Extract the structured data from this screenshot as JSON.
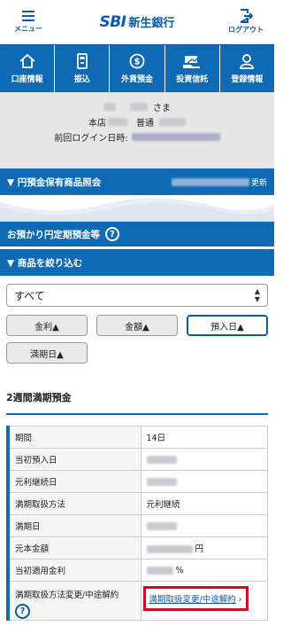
{
  "header": {
    "menu_label": "メニュー",
    "logo_mark": "SBI",
    "logo_text": "新生銀行",
    "logout_label": "ログアウト"
  },
  "nav": [
    {
      "label": "口座情報",
      "icon": "home-icon"
    },
    {
      "label": "振込",
      "icon": "transfer-icon"
    },
    {
      "label": "外貨預金",
      "icon": "dollar-coin-icon"
    },
    {
      "label": "投資信託",
      "icon": "investment-icon"
    },
    {
      "label": "登録情報",
      "icon": "person-icon"
    }
  ],
  "user": {
    "honorific": "さま",
    "branch_label": "本店",
    "account_type": "普通",
    "last_login_label": "前回ログイン日時:"
  },
  "yen_section": {
    "title": "▼ 円預金保有商品照会",
    "updated_suffix": "更新"
  },
  "deposit_section": {
    "title": "お預かり円定期預金等"
  },
  "filter": {
    "title": "▼ 商品を絞り込む",
    "select_value": "すべて",
    "sort_buttons": [
      {
        "label": "金利▲",
        "active": false
      },
      {
        "label": "金額▲",
        "active": false
      },
      {
        "label": "預入日▲",
        "active": true
      },
      {
        "label": "満期日▲",
        "active": false
      }
    ]
  },
  "product": {
    "title": "2週間満期預金",
    "rows": [
      {
        "key": "期間",
        "value": "14日"
      },
      {
        "key": "当初預入日",
        "value": ""
      },
      {
        "key": "元利継続日",
        "value": ""
      },
      {
        "key": "満期取扱方法",
        "value": "元利継続"
      },
      {
        "key": "満期日",
        "value": ""
      },
      {
        "key": "元本金額",
        "value": "",
        "unit": "円"
      },
      {
        "key": "当初適用金利",
        "value": "",
        "unit": "%"
      }
    ],
    "change_label": "満期取扱方法変更/中途解約",
    "change_link": "満期取扱変更/中途解約"
  },
  "colors": {
    "brand_blue": "#0e6ab5",
    "highlight_red": "#d10a1e"
  }
}
